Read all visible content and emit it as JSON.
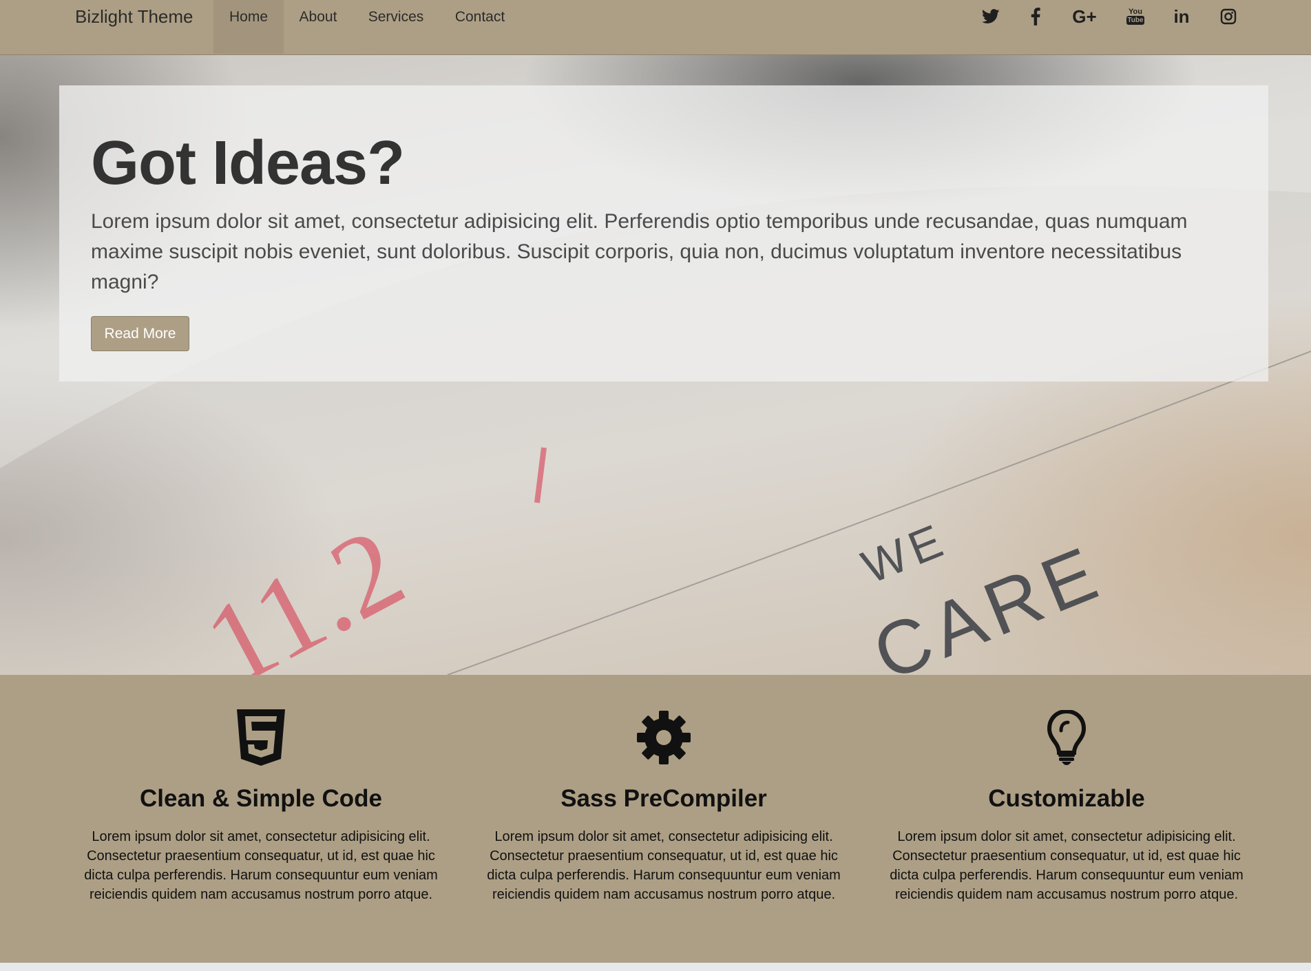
{
  "navbar": {
    "brand": "Bizlight Theme",
    "items": [
      {
        "label": "Home",
        "active": true
      },
      {
        "label": "About",
        "active": false
      },
      {
        "label": "Services",
        "active": false
      },
      {
        "label": "Contact",
        "active": false
      }
    ],
    "social_icons": [
      "twitter-icon",
      "facebook-icon",
      "google-plus-icon",
      "youtube-icon",
      "linkedin-icon",
      "instagram-icon"
    ],
    "google_plus_text": "G+",
    "linkedin_text": "in",
    "youtube_text_top": "You",
    "youtube_text_bottom": "Tube"
  },
  "hero": {
    "title": "Got Ideas?",
    "text": "Lorem ipsum dolor sit amet, consectetur adipisicing elit. Perferendis optio temporibus unde recusandae, quas numquam maxime suscipit nobis eveniet, sunt doloribus. Suscipit corporis, quia non, ducimus voluptatum inventore necessitatibus magni?",
    "button_label": "Read More",
    "background_text_number": "11.2",
    "background_text_we": "WE",
    "background_text_care": "CARE"
  },
  "features": [
    {
      "icon": "html5-icon",
      "title": "Clean & Simple Code",
      "text": "Lorem ipsum dolor sit amet, consectetur adipisicing elit. Consectetur praesentium consequatur, ut id, est quae hic dicta culpa perferendis. Harum consequuntur eum veniam reiciendis quidem nam accusamus nostrum porro atque."
    },
    {
      "icon": "gear-icon",
      "title": "Sass PreCompiler",
      "text": "Lorem ipsum dolor sit amet, consectetur adipisicing elit. Consectetur praesentium consequatur, ut id, est quae hic dicta culpa perferendis. Harum consequuntur eum veniam reiciendis quidem nam accusamus nostrum porro atque."
    },
    {
      "icon": "lightbulb-icon",
      "title": "Customizable",
      "text": "Lorem ipsum dolor sit amet, consectetur adipisicing elit. Consectetur praesentium consequatur, ut id, est quae hic dicta culpa perferendis. Harum consequuntur eum veniam reiciendis quidem nam accusamus nostrum porro atque."
    }
  ],
  "colors": {
    "navbar_bg": "#ad9f85",
    "nav_active_bg": "#a3957d",
    "features_bg": "#ad9f85",
    "button_bg": "#ad9f85",
    "text_dark": "#111111"
  }
}
